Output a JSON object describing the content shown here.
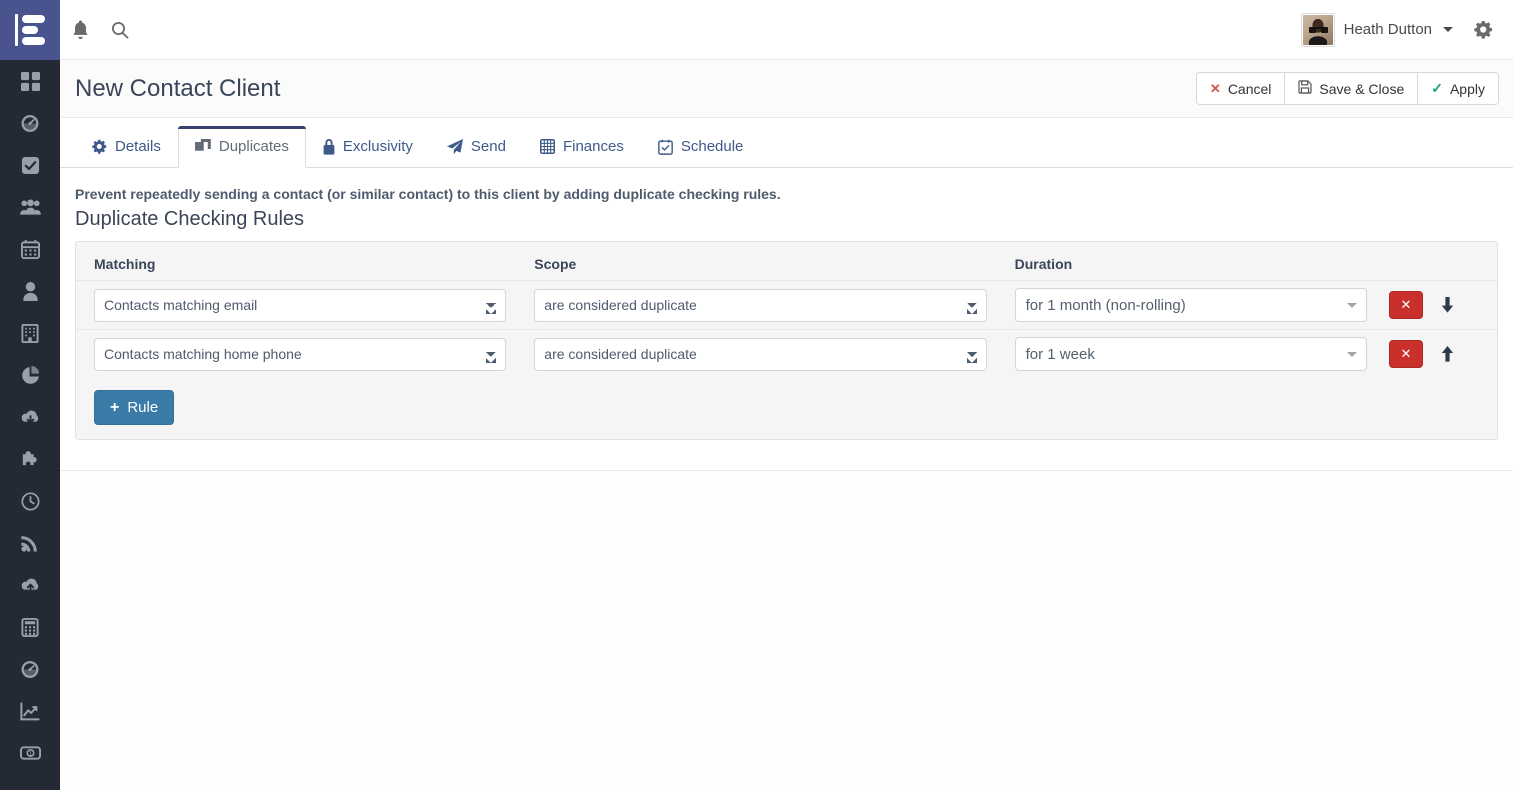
{
  "topbar": {
    "logo_name": "logo-mark",
    "notifications_icon": "bell-icon",
    "search_icon": "search-icon",
    "user_name": "Heath Dutton",
    "settings_icon": "gear-icon",
    "logo_color": "#49548f"
  },
  "sidebar": {
    "background": "#232a35",
    "items": [
      {
        "icon": "grid-dashboard-icon",
        "label": "Dashboard"
      },
      {
        "icon": "gauge-icon",
        "label": "Performance"
      },
      {
        "icon": "check-square-icon",
        "label": "Tasks"
      },
      {
        "icon": "users-icon",
        "label": "Contacts"
      },
      {
        "icon": "calendar-icon",
        "label": "Calendar"
      },
      {
        "icon": "user-icon",
        "label": "Leads"
      },
      {
        "icon": "building-icon",
        "label": "Companies"
      },
      {
        "icon": "pie-chart-icon",
        "label": "Reports"
      },
      {
        "icon": "cloud-download-icon",
        "label": "Imports"
      },
      {
        "icon": "puzzle-piece-icon",
        "label": "Plugins"
      },
      {
        "icon": "clock-icon",
        "label": "History"
      },
      {
        "icon": "rss-icon",
        "label": "Feeds"
      },
      {
        "icon": "cloud-upload-icon",
        "label": "Exports"
      },
      {
        "icon": "calculator-icon",
        "label": "Billing"
      },
      {
        "icon": "gauge-icon",
        "label": "Monitor"
      },
      {
        "icon": "line-chart-icon",
        "label": "Analytics"
      },
      {
        "icon": "money-bill-icon",
        "label": "Revenue"
      }
    ]
  },
  "page": {
    "title": "New Contact Client",
    "actions": [
      {
        "id": "cancel",
        "label": "Cancel",
        "icon": "x-icon",
        "color": "#d9534f"
      },
      {
        "id": "save-close",
        "label": "Save & Close",
        "icon": "floppy-disk-icon",
        "color": "#555555"
      },
      {
        "id": "apply",
        "label": "Apply",
        "icon": "check-icon",
        "color": "#18a07a"
      }
    ]
  },
  "tabs": [
    {
      "id": "details",
      "label": "Details",
      "icon": "gear-icon",
      "active": false
    },
    {
      "id": "duplicates",
      "label": "Duplicates",
      "icon": "clone-icon",
      "active": true
    },
    {
      "id": "exclusivity",
      "label": "Exclusivity",
      "icon": "lock-icon",
      "active": false
    },
    {
      "id": "send",
      "label": "Send",
      "icon": "paper-plane-icon",
      "active": false
    },
    {
      "id": "finances",
      "label": "Finances",
      "icon": "calculator-icon",
      "active": false
    },
    {
      "id": "schedule",
      "label": "Schedule",
      "icon": "calendar-check-icon",
      "active": false
    }
  ],
  "duplicates": {
    "lead_text": "Prevent repeatedly sending a contact (or similar contact) to this client by adding duplicate checking rules.",
    "section_title": "Duplicate Checking Rules",
    "headers": {
      "matching": "Matching",
      "scope": "Scope",
      "duration": "Duration"
    },
    "rules": [
      {
        "matching": "Contacts matching email",
        "scope": "are considered duplicate",
        "duration": "for 1 month (non-rolling)",
        "delete_icon": "x-icon",
        "move_icon": "arrow-down-icon"
      },
      {
        "matching": "Contacts matching home phone",
        "scope": "are considered duplicate",
        "duration": "for 1 week",
        "delete_icon": "x-icon",
        "move_icon": "arrow-up-icon"
      }
    ],
    "add_rule": {
      "label": "Rule",
      "icon": "plus-icon",
      "color": "#3b7ba8"
    }
  }
}
